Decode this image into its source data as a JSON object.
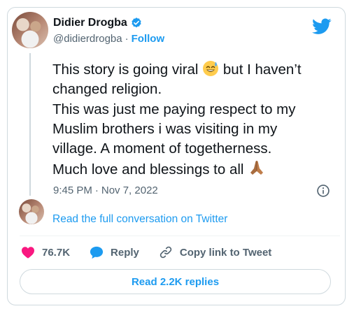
{
  "author": {
    "display_name": "Didier Drogba",
    "handle": "@didierdrogba",
    "separator": "·",
    "follow_label": "Follow"
  },
  "tweet": {
    "lines": [
      "This story is going viral",
      "but I haven’t",
      "changed religion.",
      "This was just me paying respect to my",
      "Muslim brothers i was visiting in my",
      "village. A moment of togetherness.",
      "Much love and blessings to all"
    ],
    "time": "9:45 PM",
    "separator": "·",
    "date": "Nov 7, 2022"
  },
  "conversation": {
    "read_full_label": "Read the full conversation on Twitter"
  },
  "actions": {
    "likes_count": "76.7K",
    "reply_label": "Reply",
    "copy_link_label": "Copy link to Tweet"
  },
  "replies_button": {
    "label": "Read 2.2K replies"
  },
  "icons": {
    "verified": "verified-badge-icon",
    "brand": "twitter-bird-icon",
    "info": "info-icon",
    "heart": "heart-icon",
    "reply": "reply-bubble-icon",
    "link": "link-icon",
    "emoji_1": "sweat-smile-emoji",
    "emoji_2": "folded-hands-emoji"
  },
  "colors": {
    "accent": "#1d9bf0",
    "like": "#f91880",
    "text": "#0f1419",
    "muted": "#536471",
    "border": "#cfd9de"
  }
}
